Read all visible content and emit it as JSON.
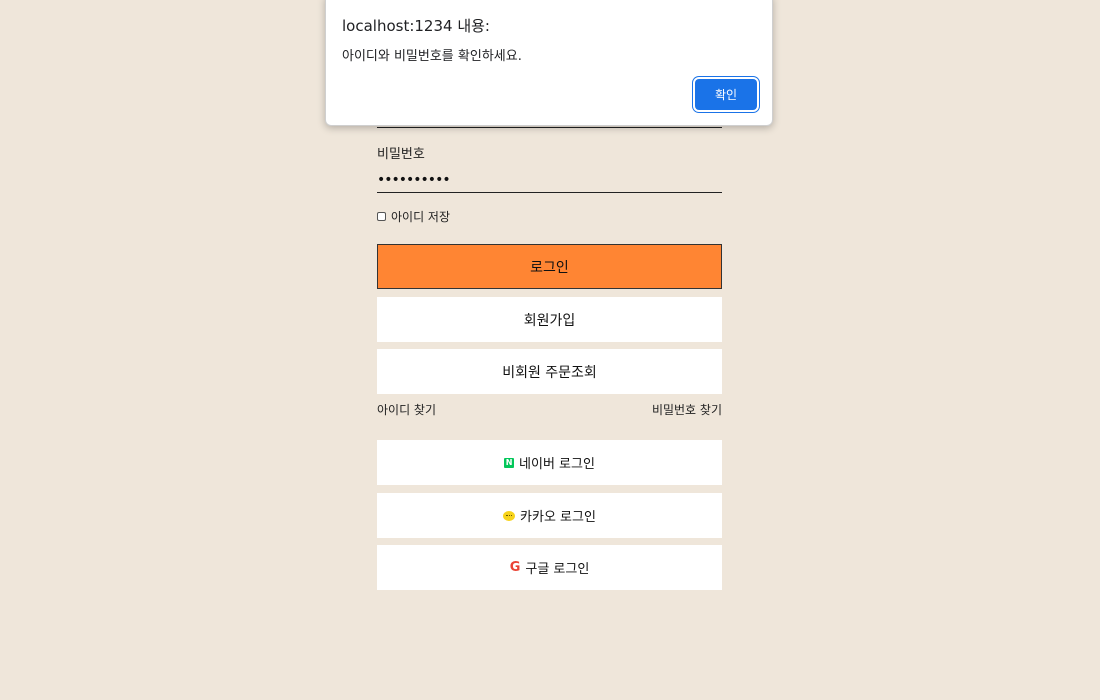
{
  "login": {
    "password_label": "비밀번호",
    "password_value": "••••••••••",
    "remember_label": "아이디 저장",
    "login_button": "로그인",
    "join_button": "회원가입",
    "guest_order_button": "비회원 주문조회",
    "find_id_link": "아이디 찾기",
    "find_password_link": "비밀번호 찾기",
    "naver_button": "네이버 로그인",
    "kakao_button": "카카오 로그인",
    "google_button": "구글 로그인",
    "naver_icon_letter": "N",
    "google_icon_letter": "G"
  },
  "dialog": {
    "title": "localhost:1234 내용:",
    "message": "아이디와 비밀번호를 확인하세요.",
    "ok_button": "확인"
  },
  "colors": {
    "background": "#efe6da",
    "login_button": "#ff8533",
    "dialog_button": "#1a73e8"
  },
  "icons": {
    "naver": "naver-logo-icon",
    "kakao": "kakao-talk-icon",
    "google": "google-logo-icon"
  }
}
